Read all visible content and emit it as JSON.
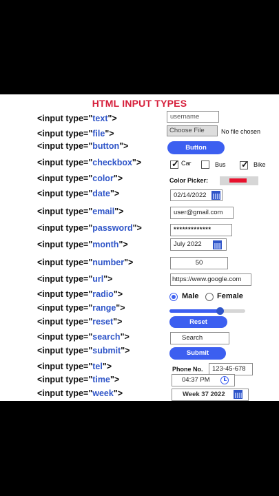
{
  "title": "HTML INPUT TYPES",
  "rows": [
    {
      "prefix": "<input type=\"",
      "type": "text",
      "suffix": "\">"
    },
    {
      "prefix": "<input type=\"",
      "type": "file",
      "suffix": "\">"
    },
    {
      "prefix": "<input type=\"",
      "type": "button",
      "suffix": "\">"
    },
    {
      "prefix": "<input type=\"",
      "type": "checkbox",
      "suffix": "\">"
    },
    {
      "prefix": "<input type=\"",
      "type": "color",
      "suffix": "\">"
    },
    {
      "prefix": "<input type=\"",
      "type": "date",
      "suffix": "\">"
    },
    {
      "prefix": "<input type=\"",
      "type": "email",
      "suffix": "\">"
    },
    {
      "prefix": "<input type=\"",
      "type": "password",
      "suffix": "\">"
    },
    {
      "prefix": "<input type=\"",
      "type": "month",
      "suffix": "\">"
    },
    {
      "prefix": "<input type=\"",
      "type": "number",
      "suffix": "\">"
    },
    {
      "prefix": "<input type=\"",
      "type": "url",
      "suffix": "\">"
    },
    {
      "prefix": "<input type=\"",
      "type": "radio",
      "suffix": "\">"
    },
    {
      "prefix": "<input type=\"",
      "type": "range",
      "suffix": "\">"
    },
    {
      "prefix": "<input type=\"",
      "type": "reset",
      "suffix": "\">"
    },
    {
      "prefix": "<input type=\"",
      "type": "search",
      "suffix": "\">"
    },
    {
      "prefix": "<input type=\"",
      "type": "submit",
      "suffix": "\">"
    },
    {
      "prefix": "<input type=\"",
      "type": "tel",
      "suffix": "\">"
    },
    {
      "prefix": "<input type=\"",
      "type": "time",
      "suffix": "\">"
    },
    {
      "prefix": "<input type=\"",
      "type": "week",
      "suffix": "\">"
    }
  ],
  "widgets": {
    "text_value": "username",
    "file_button": "Choose File",
    "file_status": "No file chosen",
    "button_label": "Button",
    "checkboxes": [
      {
        "label": "Car",
        "checked": true
      },
      {
        "label": "Bus",
        "checked": false
      },
      {
        "label": "Bike",
        "checked": true
      }
    ],
    "color_label": "Color Picker:",
    "color_value": "#e8112d",
    "date_value": "02/14/2022",
    "email_value": "user@gmail.com",
    "password_value": "*************",
    "month_value": "July 2022",
    "number_value": "50",
    "url_value": "https://www.google.com",
    "radio_options": [
      {
        "label": "Male",
        "selected": true
      },
      {
        "label": "Female",
        "selected": false
      }
    ],
    "range_level": 0.66,
    "reset_label": "Reset",
    "search_value": "Search",
    "submit_label": "Submit",
    "tel_label": "Phone No.",
    "tel_value": "123-45-678",
    "time_value": "04:37 PM",
    "week_value": "Week 37  2022"
  },
  "colors": {
    "accent": "#3c5ff0",
    "title": "#d61e3a",
    "type_text": "#2f55c8"
  }
}
